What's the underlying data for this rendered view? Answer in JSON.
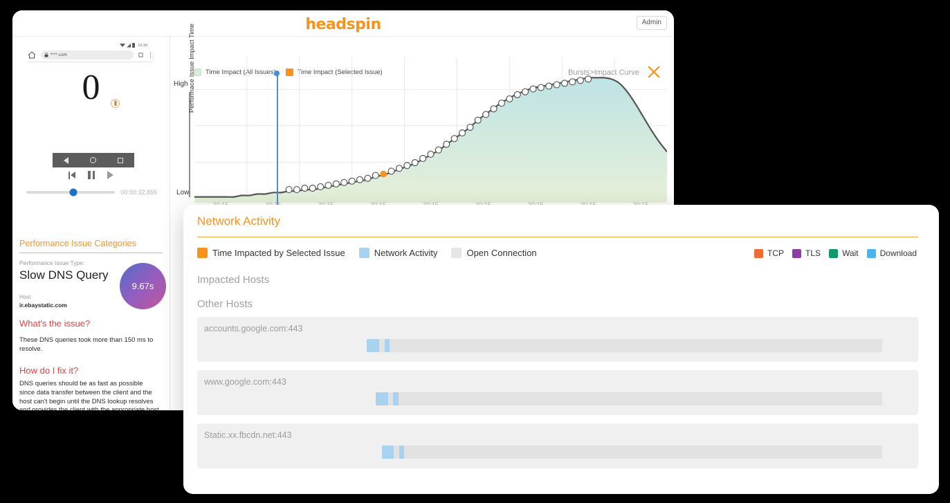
{
  "app": {
    "logo": "headspin",
    "admin_label": "Admin",
    "accent_orange": "#f7941e"
  },
  "device": {
    "url_text": "****.com",
    "clock": "12:30",
    "counter": "0",
    "seek_time": "00:00:32.856",
    "icons": {
      "home": "home-icon",
      "lock": "lock-icon",
      "back": "nav-back-icon",
      "circle": "nav-home-icon",
      "square": "nav-recent-icon",
      "prev": "skip-previous-icon",
      "pause": "pause-icon",
      "play": "play-icon"
    }
  },
  "categories": {
    "title": "Performance Issue Categories",
    "issue_type_label": "Performance Issue Type:",
    "issue_type": "Slow DNS Query",
    "host_label": "Host",
    "host_value": "ir.ebaystatic.com",
    "score": "9.67s",
    "q1_heading": "What's the issue?",
    "q1_body": "These DNS queries took more than 150 ms to resolve.",
    "q2_heading": "How do I fix it?",
    "q2_body": "DNS queries should be as fast as possible since data transfer between the client and the host can't begin until the DNS lookup resolves and provides the client with the appropriate host IP address. Slow DNS lookups will negatively impact the time to first load and contribute to a poor user experience."
  },
  "chart_header": {
    "legend": [
      {
        "label": "Time Impact (All Issues)",
        "color": "#d9ecdc"
      },
      {
        "label": "Time Impact (Selected Issue)",
        "color": "#f7941e"
      }
    ],
    "breadcrumb": "Bursts>Impact Curve",
    "close_icon": "close-icon"
  },
  "chart_data": {
    "type": "area",
    "title": "",
    "xlabel": "",
    "ylabel": "Performace Issue Impact Time",
    "ytick_labels": [
      "High",
      "Low"
    ],
    "ylim": [
      0,
      100
    ],
    "grid": true,
    "legend_position": "top-left",
    "xtick_labels": [
      "30:15",
      "30:15",
      "30:15",
      "30:15",
      "30:15",
      "30:15",
      "30:15",
      "30:15",
      "30:15"
    ],
    "x": [
      0,
      1,
      2,
      3,
      4,
      5,
      6,
      7,
      8,
      9,
      10,
      11,
      12,
      13,
      14,
      15,
      16,
      17,
      18,
      19,
      20,
      21,
      22,
      23,
      24,
      25,
      26,
      27,
      28,
      29,
      30,
      31,
      32,
      33,
      34,
      35,
      36,
      37,
      38,
      39,
      40,
      41,
      42,
      43,
      44,
      45,
      46,
      47,
      48,
      49,
      50,
      51,
      52,
      53,
      54,
      55,
      56,
      57,
      58,
      59,
      60
    ],
    "values": [
      4,
      4,
      4,
      4,
      4,
      4,
      5,
      5,
      6,
      6,
      7,
      7,
      8,
      8,
      9,
      9,
      10,
      11,
      12,
      13,
      14,
      15,
      16,
      18,
      19,
      21,
      23,
      25,
      27,
      30,
      33,
      36,
      40,
      44,
      48,
      52,
      57,
      61,
      65,
      69,
      72,
      75,
      77,
      79,
      80,
      81,
      82,
      83,
      84,
      85,
      86,
      86,
      86,
      85,
      82,
      76,
      68,
      59,
      50,
      42,
      35
    ],
    "selected_point": {
      "x": 24,
      "y": 19,
      "color": "#f7941e"
    },
    "playhead": {
      "x": 24,
      "color": "#4a90d9"
    },
    "marker_start": 12,
    "marker_end": 50,
    "area_gradient": [
      "#bfe3e5",
      "#e3efd6"
    ],
    "line_color": "#555555"
  },
  "network": {
    "title": "Network Activity",
    "legend_left": [
      {
        "label": "Time Impacted by Selected Issue",
        "color": "#f7941e"
      },
      {
        "label": "Network Activity",
        "color": "#a9d2ee"
      },
      {
        "label": "Open Connection",
        "color": "#e6e6e6"
      }
    ],
    "legend_right": [
      {
        "label": "TCP",
        "color": "#ef6c33"
      },
      {
        "label": "TLS",
        "color": "#8b3fa0"
      },
      {
        "label": "Wait",
        "color": "#11996b"
      },
      {
        "label": "Download",
        "color": "#48b5f0"
      }
    ],
    "impacted_hosts_label": "Impacted Hosts",
    "other_hosts_label": "Other Hosts",
    "rows": [
      {
        "host": "accounts.google.com:443",
        "track_left_pct": 23.5,
        "track_width_pct": 71.5,
        "segments": [
          {
            "left_pct": 23.5,
            "width_pct": 1.7
          },
          {
            "left_pct": 26.0,
            "width_pct": 0.7
          }
        ]
      },
      {
        "host": "www.google.com:443",
        "track_left_pct": 24.8,
        "track_width_pct": 70.2,
        "segments": [
          {
            "left_pct": 24.8,
            "width_pct": 1.7
          },
          {
            "left_pct": 27.2,
            "width_pct": 0.7
          }
        ]
      },
      {
        "host": "Static.xx.fbcdn.net:443",
        "track_left_pct": 25.6,
        "track_width_pct": 69.4,
        "segments": [
          {
            "left_pct": 25.6,
            "width_pct": 1.7
          },
          {
            "left_pct": 28.0,
            "width_pct": 0.7
          }
        ]
      }
    ]
  }
}
